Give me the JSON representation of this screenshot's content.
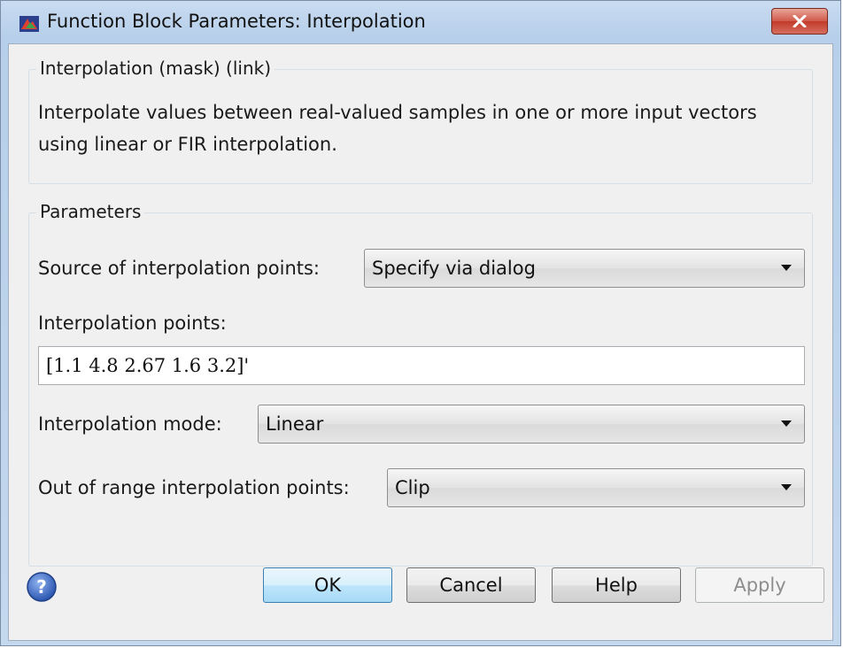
{
  "window": {
    "title": "Function Block Parameters: Interpolation"
  },
  "description": {
    "group_title": "Interpolation (mask) (link)",
    "text": "Interpolate values between real-valued samples in one or more input vectors using linear or FIR interpolation."
  },
  "parameters": {
    "group_title": "Parameters",
    "source": {
      "label": "Source of interpolation points:",
      "value": "Specify via dialog"
    },
    "points": {
      "label": "Interpolation points:",
      "value": "[1.1 4.8 2.67 1.6 3.2]'"
    },
    "mode": {
      "label": "Interpolation mode:",
      "value": "Linear"
    },
    "out_of_range": {
      "label": "Out of range interpolation points:",
      "value": "Clip"
    }
  },
  "buttons": {
    "ok": "OK",
    "cancel": "Cancel",
    "help": "Help",
    "apply": "Apply"
  },
  "icons": {
    "app": "simulink-block-icon",
    "close": "close-icon",
    "help": "question-mark-icon",
    "dropdown": "chevron-down-icon"
  },
  "colors": {
    "default_button": "#bee6fd",
    "close_button": "#c23a2a"
  }
}
